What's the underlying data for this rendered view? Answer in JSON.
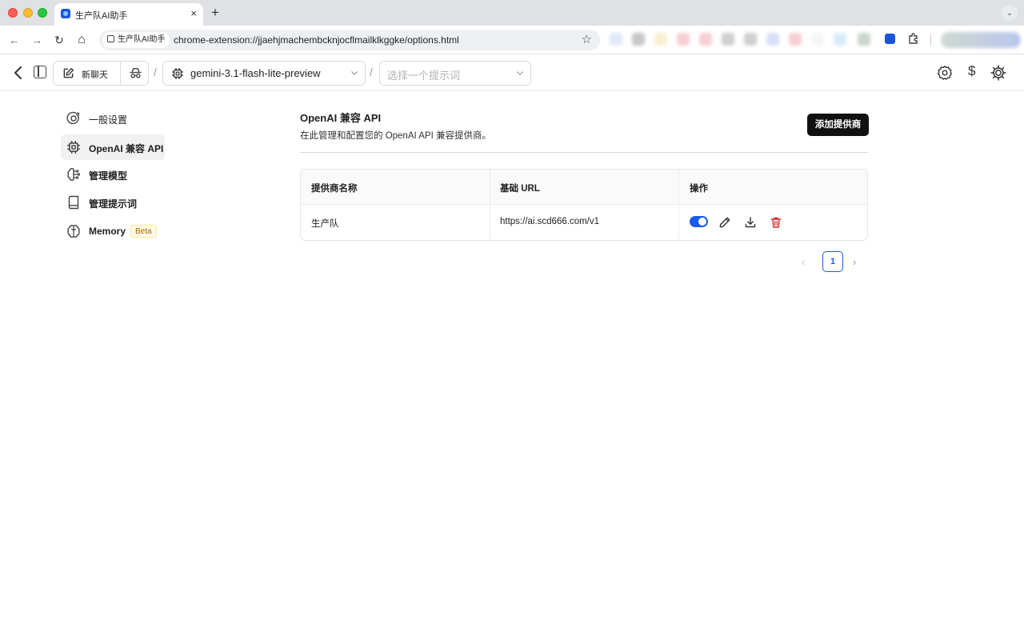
{
  "browser": {
    "tab_title": "生产队AI助手",
    "tab_close": "×",
    "new_tab": "+",
    "tab_menu": "⌄",
    "site_chip": "生产队AI助手",
    "url": "chrome-extension://jjaehjmachembcknjocflmailklkggke/options.html",
    "nav": {
      "back": "←",
      "forward": "→",
      "reload": "↻",
      "home": "⌂",
      "star": "☆"
    }
  },
  "appbar": {
    "new_chat_label": "新聊天",
    "separator": "/",
    "model": "gemini-3.1-flash-lite-preview",
    "prompt_placeholder": "选择一个提示词",
    "dollar": "$"
  },
  "sidebar": {
    "items": [
      {
        "label": "一般设置",
        "icon": "orbit-settings-icon",
        "active": false
      },
      {
        "label": "OpenAI 兼容 API",
        "icon": "cpu-chip-icon",
        "active": true
      },
      {
        "label": "管理模型",
        "icon": "brain-circuit-icon",
        "active": false
      },
      {
        "label": "管理提示词",
        "icon": "book-icon",
        "active": false
      },
      {
        "label": "Memory",
        "icon": "brain-icon",
        "active": false,
        "badge": "Beta"
      }
    ]
  },
  "main": {
    "title": "OpenAI 兼容 API",
    "description": "在此管理和配置您的 OpenAI API 兼容提供商。",
    "add_button": "添加提供商",
    "table": {
      "headers": [
        "提供商名称",
        "基础 URL",
        "操作"
      ],
      "rows": [
        {
          "name": "生产队",
          "url": "https://ai.scd666.com/v1",
          "enabled": true
        }
      ]
    },
    "pagination": {
      "prev": "‹",
      "current": "1",
      "next": "›"
    }
  },
  "colors": {
    "accent": "#1d5bf0",
    "danger": "#dc2626",
    "primary_button": "#111111",
    "beta_badge": "#a16207"
  }
}
